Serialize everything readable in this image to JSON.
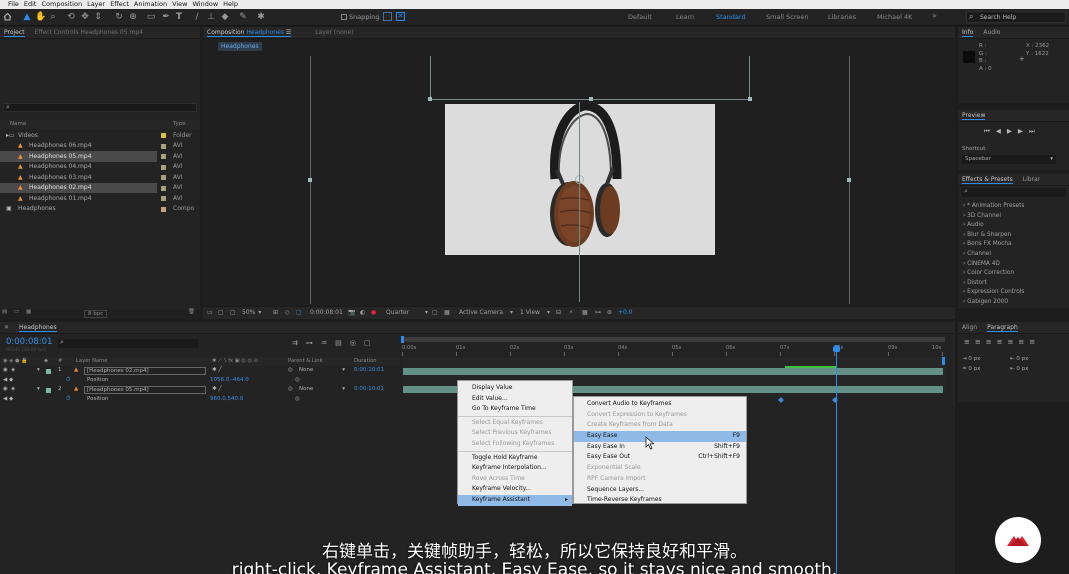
{
  "menubar": {
    "items": [
      "File",
      "Edit",
      "Composition",
      "Layer",
      "Effect",
      "Animation",
      "View",
      "Window",
      "Help"
    ]
  },
  "toolbar": {
    "snapping_label": "Snapping",
    "workspaces": [
      "Default",
      "Learn",
      "Standard",
      "Small Screen",
      "Libraries",
      "Michael 4K"
    ],
    "active_workspace": "Standard",
    "overflow": "»",
    "search_placeholder": "Search Help"
  },
  "project": {
    "tab_project": "Project",
    "tab_effect_controls": "Effect Controls Headphones 05.mp4",
    "col_name": "Name",
    "col_type": "Type",
    "items": [
      {
        "name": "Videos",
        "type": "Folder",
        "indent": 0,
        "selected": false,
        "kind": "folder"
      },
      {
        "name": "Headphones 06.mp4",
        "type": "AVI",
        "indent": 1,
        "selected": false,
        "kind": "video"
      },
      {
        "name": "Headphones 05.mp4",
        "type": "AVI",
        "indent": 1,
        "selected": true,
        "kind": "video"
      },
      {
        "name": "Headphones 04.mp4",
        "type": "AVI",
        "indent": 1,
        "selected": false,
        "kind": "video"
      },
      {
        "name": "Headphones 03.mp4",
        "type": "AVI",
        "indent": 1,
        "selected": false,
        "kind": "video"
      },
      {
        "name": "Headphones 02.mp4",
        "type": "AVI",
        "indent": 1,
        "selected": true,
        "kind": "video"
      },
      {
        "name": "Headphones 01.mp4",
        "type": "AVI",
        "indent": 1,
        "selected": false,
        "kind": "video"
      },
      {
        "name": "Headphones",
        "type": "Compo",
        "indent": 0,
        "selected": false,
        "kind": "comp"
      }
    ],
    "bpc": "8 bpc"
  },
  "composition": {
    "tab_label": "Composition",
    "tab_name": "Headphones",
    "layer_tab": "Layer (none)",
    "breadcrumb": "Headphones",
    "zoom": "50%",
    "timecode": "0:00:08:01",
    "resolution": "Quarter",
    "camera": "Active Camera",
    "views": "1 View",
    "exposure": "+0.0"
  },
  "info": {
    "tab_info": "Info",
    "tab_audio": "Audio",
    "r": "R :",
    "g": "G :",
    "b": "B :",
    "a": "A : 0",
    "x": "X : 2362",
    "y": "Y : 1622"
  },
  "preview": {
    "title": "Preview",
    "shortcut_label": "Shortcut",
    "shortcut_value": "Spacebar"
  },
  "effects": {
    "tab_label": "Effects & Presets",
    "tab_library": "Librar",
    "items": [
      "* Animation Presets",
      "3D Channel",
      "Audio",
      "Blur & Sharpen",
      "Boris FX Mocha",
      "Channel",
      "CINEMA 4D",
      "Color Correction",
      "Distort",
      "Expression Controls",
      "Gabigen 2000"
    ]
  },
  "align": {
    "tab_align": "Align",
    "tab_paragraph": "Paragraph",
    "px": [
      "0 px",
      "0 px",
      "0 px",
      "0 px",
      "0 px"
    ]
  },
  "timeline": {
    "comp_name": "Headphones",
    "timecode": "0:00:08:01",
    "fps": "00241 (30.00 fps)",
    "col_layer_name": "Layer Name",
    "col_parent": "Parent & Link",
    "col_duration": "Duration",
    "ruler": [
      "0:00s",
      "01s",
      "02s",
      "03s",
      "04s",
      "05s",
      "06s",
      "07s",
      "08s",
      "09s",
      "10s"
    ],
    "layers": [
      {
        "num": "1",
        "name": "[Headphones 02.mp4]",
        "parent": "None",
        "duration": "0:00:10:01",
        "prop": "Position",
        "value": "1056.0,-464.0"
      },
      {
        "num": "2",
        "name": "[Headphones 05.mp4]",
        "parent": "None",
        "duration": "0:00:10:01",
        "prop": "Position",
        "value": "960.0,540.0"
      }
    ]
  },
  "context_menu": {
    "items": [
      {
        "label": "Display Value",
        "disabled": false
      },
      {
        "label": "Edit Value...",
        "disabled": false
      },
      {
        "label": "Go To Keyframe Time",
        "disabled": false
      },
      {
        "sep": true
      },
      {
        "label": "Select Equal Keyframes",
        "disabled": true
      },
      {
        "label": "Select Previous Keyframes",
        "disabled": true
      },
      {
        "label": "Select Following Keyframes",
        "disabled": true
      },
      {
        "sep": true
      },
      {
        "label": "Toggle Hold Keyframe",
        "disabled": false
      },
      {
        "label": "Keyframe Interpolation...",
        "disabled": false
      },
      {
        "label": "Rove Across Time",
        "disabled": true
      },
      {
        "label": "Keyframe Velocity...",
        "disabled": false
      },
      {
        "label": "Keyframe Assistant",
        "disabled": false,
        "highlight": true,
        "submenu": true
      }
    ]
  },
  "submenu": {
    "items": [
      {
        "label": "Convert Audio to Keyframes",
        "shortcut": "",
        "disabled": false
      },
      {
        "label": "Convert Expression to Keyframes",
        "shortcut": "",
        "disabled": true
      },
      {
        "label": "Create Keyframes from Data",
        "shortcut": "",
        "disabled": true
      },
      {
        "label": "Easy Ease",
        "shortcut": "F9",
        "disabled": false,
        "highlight": true
      },
      {
        "label": "Easy Ease In",
        "shortcut": "Shift+F9",
        "disabled": false
      },
      {
        "label": "Easy Ease Out",
        "shortcut": "Ctrl+Shift+F9",
        "disabled": false
      },
      {
        "label": "Exponential Scale",
        "shortcut": "",
        "disabled": true
      },
      {
        "label": "RPF Camera Import",
        "shortcut": "",
        "disabled": true
      },
      {
        "label": "Sequence Layers...",
        "shortcut": "",
        "disabled": false
      },
      {
        "label": "Time-Reverse Keyframes",
        "shortcut": "",
        "disabled": false
      }
    ]
  },
  "subtitles": {
    "zh": "右键单击，关键帧助手，轻松，所以它保持良好和平滑。",
    "en": "right-click, Keyframe Assistant, Easy Ease, so it stays nice and smooth."
  },
  "colors": {
    "accent": "#2d8ceb",
    "timecode": "#3a8ee6",
    "logo": "#d9232e",
    "highlight": "#8fb9e6"
  }
}
